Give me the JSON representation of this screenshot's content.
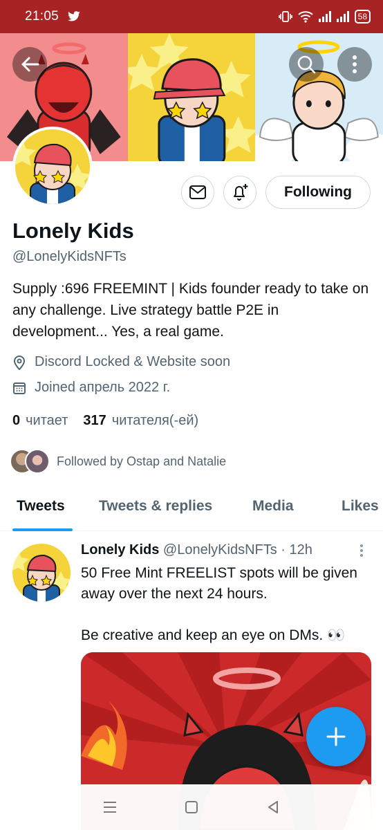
{
  "status_bar": {
    "time": "21:05",
    "battery": "58",
    "icons": [
      "twitter-icon",
      "vibrate-icon",
      "wifi-icon",
      "signal-icon",
      "signal-icon",
      "battery-icon"
    ]
  },
  "header": {
    "back_icon": "arrow-left-icon",
    "search_icon": "search-icon",
    "more_icon": "more-vertical-icon"
  },
  "profile": {
    "name": "Lonely Kids",
    "handle": "@LonelyKidsNFTs",
    "bio": "Supply :696 FREEMINT | Kids founder ready to take on any challenge. Live strategy battle P2E in development... Yes, a real game.",
    "location": "Discord Locked & Website soon",
    "joined": "Joined апрель 2022 г.",
    "following_count": "0",
    "following_label": "читает",
    "followers_count": "317",
    "followers_label": "читателя(-ей)",
    "followed_by": "Followed by Ostap and Natalie"
  },
  "actions": {
    "message_icon": "mail-icon",
    "notify_icon": "bell-plus-icon",
    "follow_label": "Following"
  },
  "tabs": [
    {
      "label": "Tweets",
      "active": true
    },
    {
      "label": "Tweets & replies",
      "active": false
    },
    {
      "label": "Media",
      "active": false
    },
    {
      "label": "Likes",
      "active": false
    }
  ],
  "tweet": {
    "author_name": "Lonely Kids",
    "author_handle": "@LonelyKidsNFTs",
    "separator": "·",
    "time": "12h",
    "text": "50 Free Mint FREELIST spots will be given away over the next 24 hours.\n\nBe creative and keep an eye on DMs. 👀"
  },
  "fab_icon": "plus-icon",
  "nav": {
    "icons": [
      "menu-icon",
      "home-square-icon",
      "back-triangle-icon"
    ]
  },
  "colors": {
    "status_bar": "#a82323",
    "accent": "#1d9bf0",
    "text_primary": "#0f1419",
    "text_secondary": "#536471",
    "border": "#cfd9de"
  }
}
